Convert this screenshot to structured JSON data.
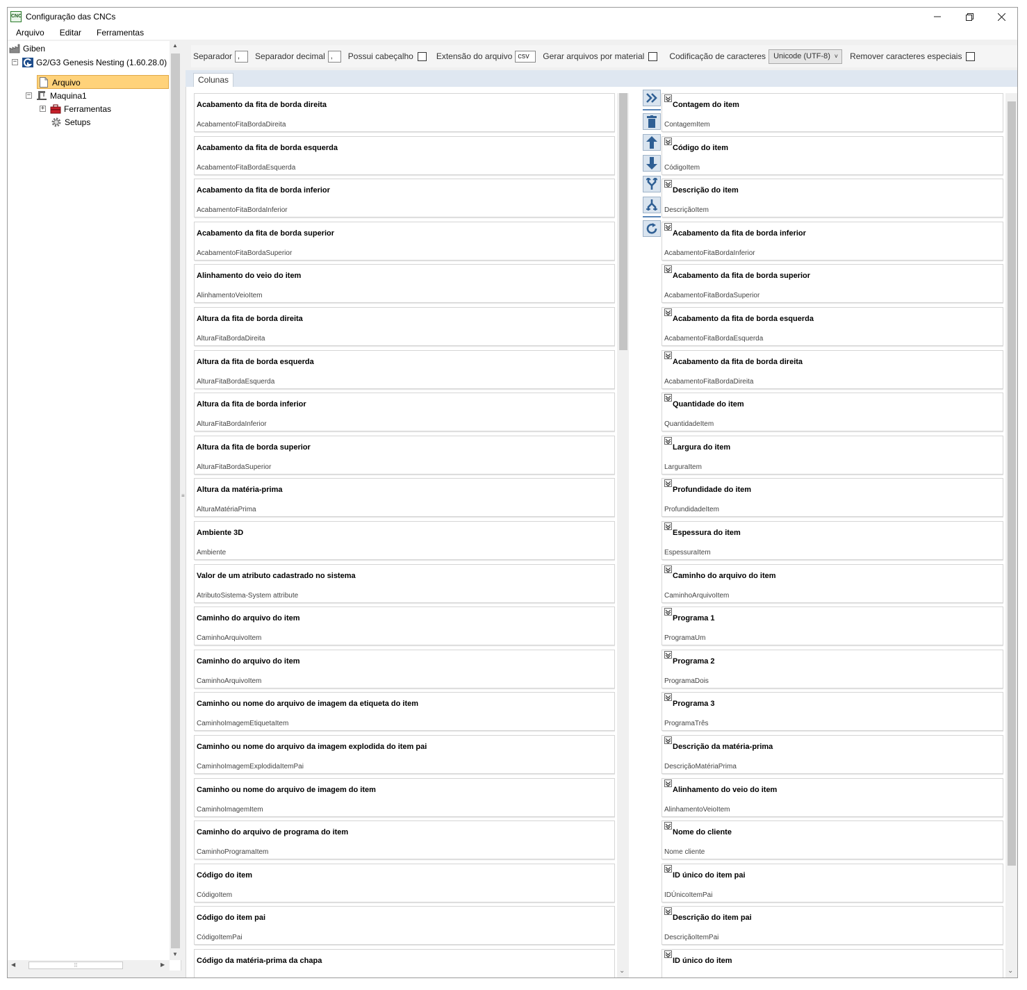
{
  "window": {
    "title": "Configuração das CNCs",
    "app_icon_text": "CNC"
  },
  "menu": [
    "Arquivo",
    "Editar",
    "Ferramentas"
  ],
  "tree": {
    "root": "Giben",
    "machine_model": "G2/G3 Genesis Nesting (1.60.28.0)",
    "selected": "Arquivo",
    "machine": "Maquina1",
    "tools": "Ferramentas",
    "setups": "Setups"
  },
  "toolbar": {
    "separator_label": "Separador",
    "separator_value": ",",
    "decimal_label": "Separador decimal",
    "decimal_value": ",",
    "header_label": "Possui cabeçalho",
    "extension_label": "Extensão do arquivo",
    "extension_value": "csv",
    "per_material_label": "Gerar arquivos por material",
    "encoding_label": "Codificação de caracteres",
    "encoding_value": "Unicode (UTF-8)",
    "remove_special_label": "Remover caracteres especiais"
  },
  "tabs": [
    "Colunas"
  ],
  "available_columns": [
    {
      "title": "Acabamento da fita de borda direita",
      "field": "AcabamentoFitaBordaDireita"
    },
    {
      "title": "Acabamento da fita de borda esquerda",
      "field": "AcabamentoFitaBordaEsquerda"
    },
    {
      "title": "Acabamento da fita de borda inferior",
      "field": "AcabamentoFitaBordaInferior"
    },
    {
      "title": "Acabamento da fita de borda superior",
      "field": "AcabamentoFitaBordaSuperior"
    },
    {
      "title": "Alinhamento do veio do item",
      "field": "AlinhamentoVeioItem"
    },
    {
      "title": "Altura da fita de borda direita",
      "field": "AlturaFitaBordaDireita"
    },
    {
      "title": "Altura da fita de borda esquerda",
      "field": "AlturaFitaBordaEsquerda"
    },
    {
      "title": "Altura da fita de borda inferior",
      "field": "AlturaFitaBordaInferior"
    },
    {
      "title": "Altura da fita de borda superior",
      "field": "AlturaFitaBordaSuperior"
    },
    {
      "title": "Altura da matéria-prima",
      "field": "AlturaMatériaPrima"
    },
    {
      "title": "Ambiente 3D",
      "field": "Ambiente"
    },
    {
      "title": "Valor de um atributo cadastrado no sistema",
      "field": "AtributoSistema-System attribute"
    },
    {
      "title": "Caminho do arquivo do item",
      "field": "CaminhoArquivoItem"
    },
    {
      "title": "Caminho do arquivo do item",
      "field": "CaminhoArquivoItem"
    },
    {
      "title": "Caminho ou nome do arquivo de imagem da etiqueta do item",
      "field": "CaminhoImagemEtiquetaItem"
    },
    {
      "title": "Caminho ou nome do arquivo da imagem explodida do item pai",
      "field": "CaminhoImagemExplodidaItemPai"
    },
    {
      "title": "Caminho ou nome do arquivo de imagem do item",
      "field": "CaminhoImagemItem"
    },
    {
      "title": "Caminho do arquivo de programa do item",
      "field": "CaminhoProgramaItem"
    },
    {
      "title": "Código do item",
      "field": "CódigoItem"
    },
    {
      "title": "Código do item pai",
      "field": "CódigoItemPai"
    },
    {
      "title": "Código da matéria-prima da chapa",
      "field": ""
    }
  ],
  "selected_columns": [
    {
      "title": "Contagem do item",
      "field": "ContagemItem"
    },
    {
      "title": "Código do item",
      "field": "CódigoItem"
    },
    {
      "title": "Descrição do item",
      "field": "DescriçãoItem"
    },
    {
      "title": "Acabamento da fita de borda inferior",
      "field": "AcabamentoFitaBordaInferior"
    },
    {
      "title": "Acabamento da fita de borda superior",
      "field": "AcabamentoFitaBordaSuperior"
    },
    {
      "title": "Acabamento da fita de borda esquerda",
      "field": "AcabamentoFitaBordaEsquerda"
    },
    {
      "title": "Acabamento da fita de borda direita",
      "field": "AcabamentoFitaBordaDireita"
    },
    {
      "title": "Quantidade do item",
      "field": "QuantidadeItem"
    },
    {
      "title": "Largura do item",
      "field": "LarguraItem"
    },
    {
      "title": "Profundidade do item",
      "field": "ProfundidadeItem"
    },
    {
      "title": "Espessura do item",
      "field": "EspessuraItem"
    },
    {
      "title": "Caminho do arquivo do item",
      "field": "CaminhoArquivoItem"
    },
    {
      "title": "Programa 1",
      "field": "ProgramaUm"
    },
    {
      "title": "Programa 2",
      "field": "ProgramaDois"
    },
    {
      "title": "Programa 3",
      "field": "ProgramaTrês"
    },
    {
      "title": "Descrição da matéria-prima",
      "field": "DescriçãoMatériaPrima"
    },
    {
      "title": "Alinhamento do veio do item",
      "field": "AlinhamentoVeioItem"
    },
    {
      "title": "Nome do cliente",
      "field": "Nome cliente"
    },
    {
      "title": "ID único do item pai",
      "field": "IDÚnicoItemPai"
    },
    {
      "title": "Descrição do item pai",
      "field": "DescriçãoItemPai"
    },
    {
      "title": "ID único do item",
      "field": ""
    }
  ],
  "colors": {
    "selection": "#ffd27a",
    "tab_strip": "#dfe7f1",
    "action_button": "#d9e4ef",
    "action_icon": "#2f5f94"
  },
  "actions": [
    "double-chevron-right-icon",
    "trash-icon",
    "arrow-up-icon",
    "arrow-down-icon",
    "merge-icon",
    "split-icon",
    "refresh-icon"
  ]
}
